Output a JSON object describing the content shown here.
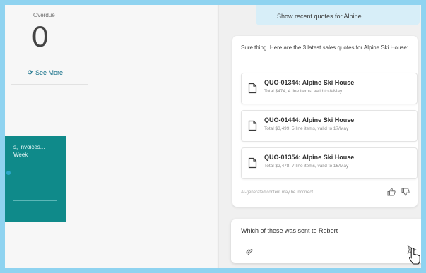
{
  "overdue": {
    "label": "Overdue",
    "count": "0",
    "see_more": "See More"
  },
  "teal_tile": {
    "line1": "s, Invoices...",
    "line2": "Week"
  },
  "copilot": {
    "user_message": "Show recent quotes for Alpine",
    "response_intro": "Sure thing. Here are the 3 latest sales quotes for Alpine Ski House:",
    "quotes": [
      {
        "title": "QUO-01344: Alpine Ski House",
        "detail": "Total $474, 4 line items, valid to 8/May"
      },
      {
        "title": "QUO-01444: Alpine Ski House",
        "detail": "Total $3,499, 5 line items, valid to 17/May"
      },
      {
        "title": "QUO-01354: Alpine Ski House",
        "detail": "Total $2,478, 7 line items, valid to 16/May"
      }
    ],
    "disclaimer": "AI-generated content may be incorrect",
    "input_value": "Which of these was sent to Robert"
  },
  "colors": {
    "frame_border": "#8fd3f0",
    "tile_teal": "#0f8a8a",
    "user_bubble": "#d7eef8",
    "link": "#0f6c86"
  },
  "icons": [
    "see-more-icon",
    "document-icon",
    "thumbs-up-icon",
    "thumbs-down-icon",
    "attach-icon",
    "send-icon",
    "cursor-pointer-icon"
  ]
}
